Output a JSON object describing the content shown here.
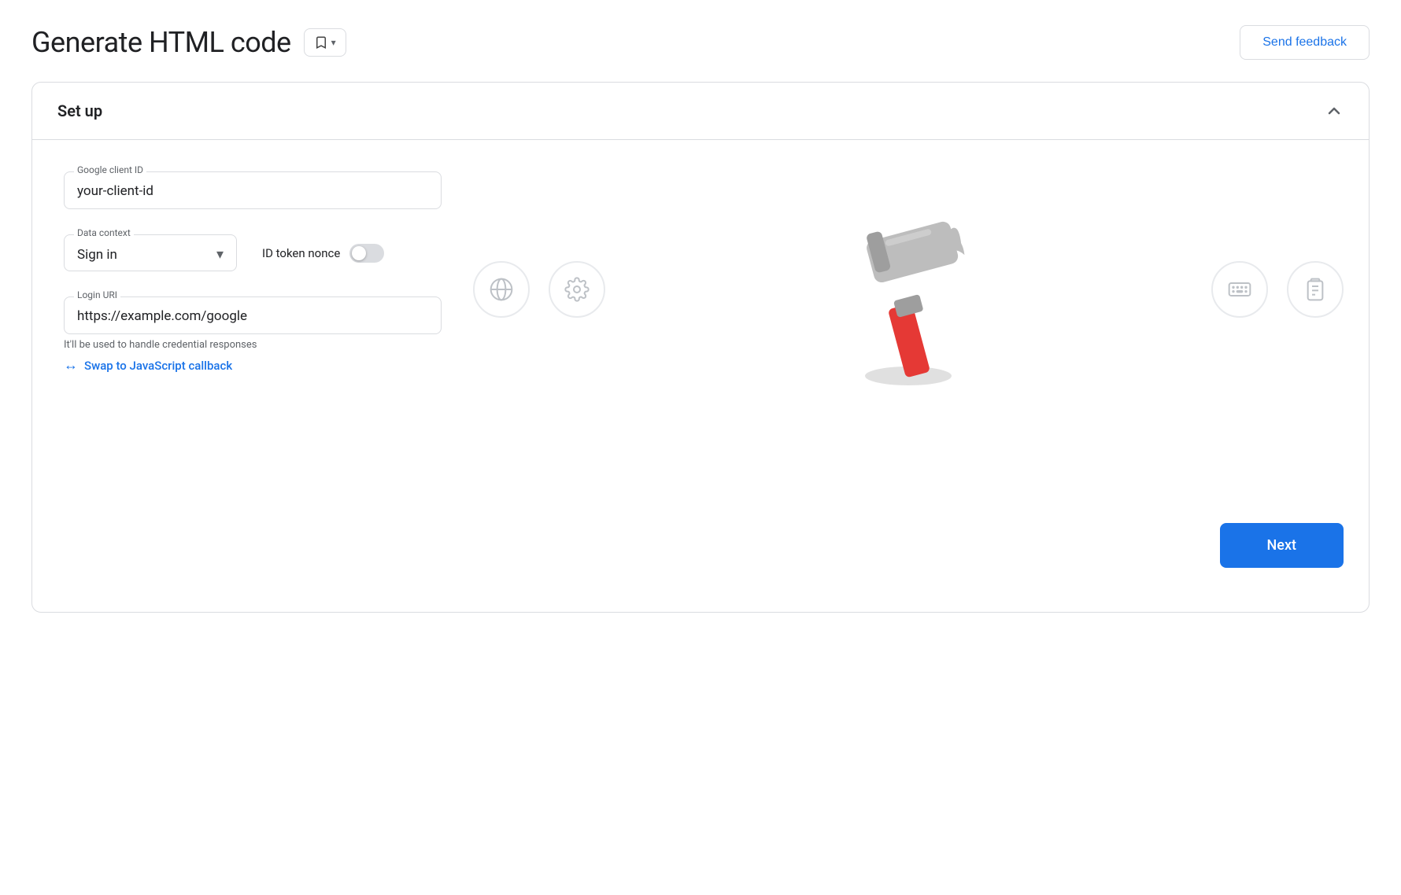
{
  "header": {
    "title": "Generate HTML code",
    "bookmark_button_label": "▾",
    "send_feedback_label": "Send feedback"
  },
  "card": {
    "section_title": "Set up",
    "collapse_icon": "^"
  },
  "form": {
    "client_id": {
      "label": "Google client ID",
      "value": "your-client-id"
    },
    "data_context": {
      "label": "Data context",
      "value": "Sign in"
    },
    "id_token_nonce": {
      "label": "ID token nonce"
    },
    "login_uri": {
      "label": "Login URI",
      "value": "https://example.com/google",
      "helper": "It'll be used to handle credential responses"
    },
    "swap_link": {
      "text": "Swap to JavaScript callback",
      "icon": "⇄"
    }
  },
  "icons": [
    {
      "name": "globe-icon",
      "title": "Globe"
    },
    {
      "name": "settings-icon",
      "title": "Settings"
    },
    {
      "name": "spacer",
      "title": ""
    },
    {
      "name": "keyboard-icon",
      "title": "Keyboard"
    },
    {
      "name": "clipboard-icon",
      "title": "Clipboard"
    }
  ],
  "next_button": {
    "label": "Next"
  }
}
